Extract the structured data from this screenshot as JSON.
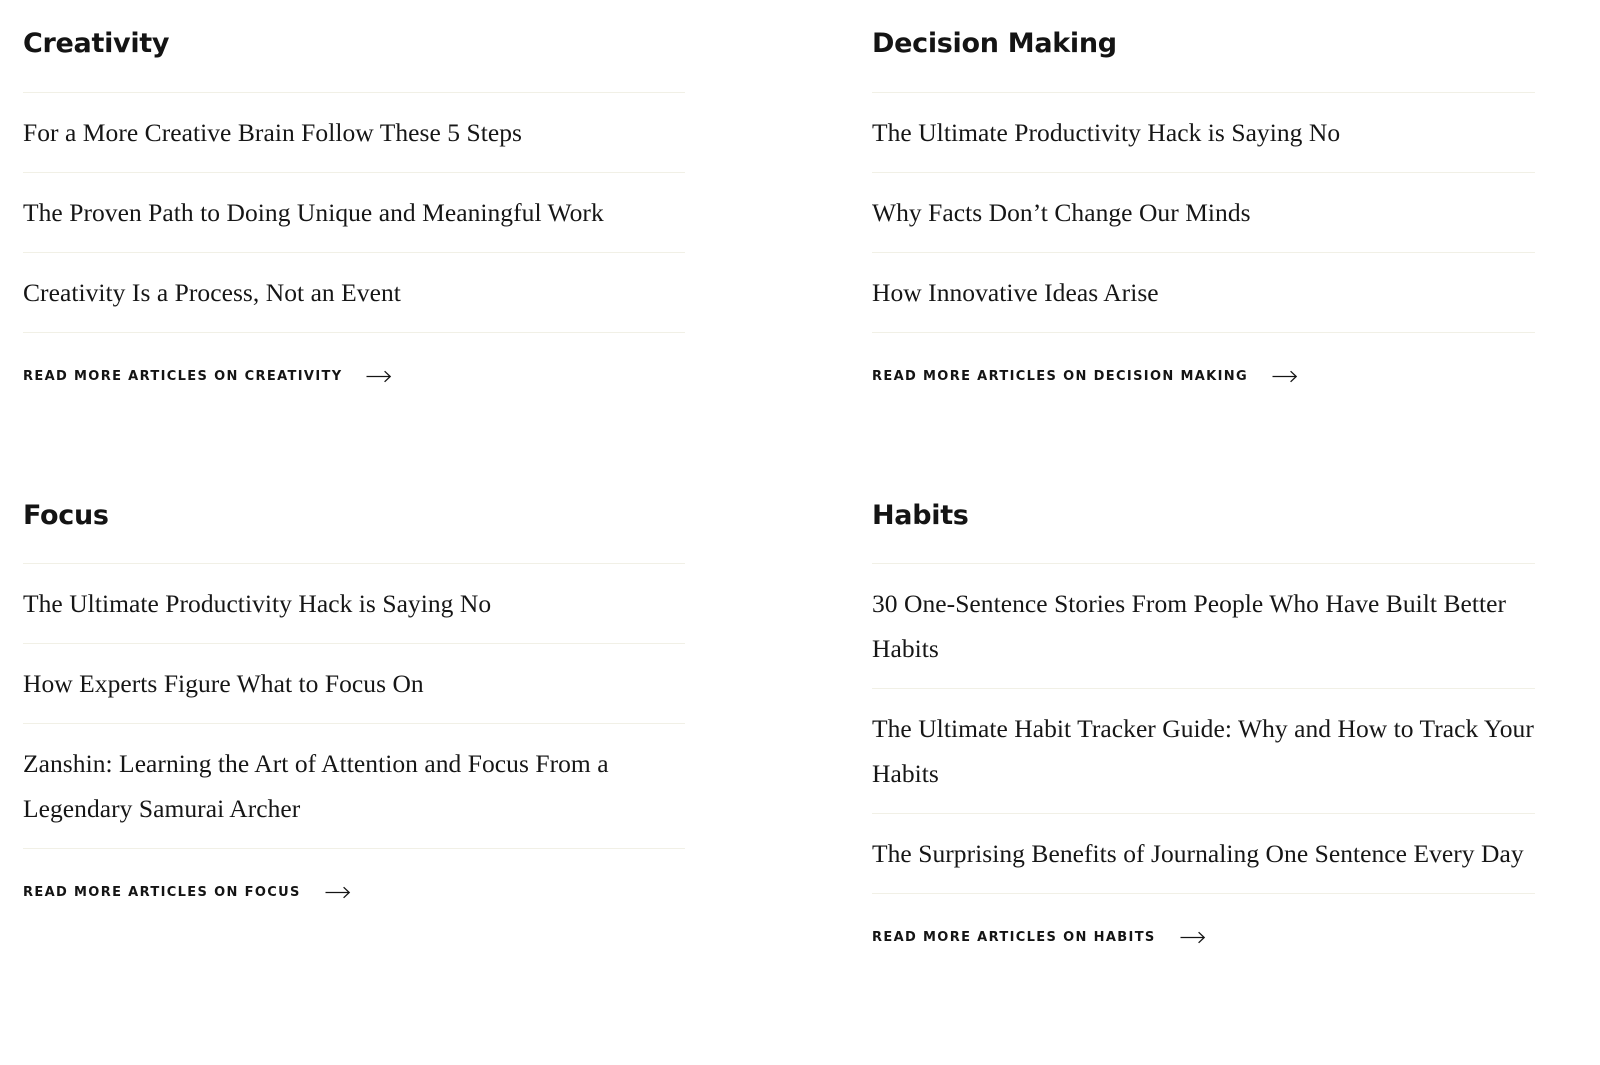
{
  "theme": {
    "background": "#ffffff",
    "text_color": "#161616",
    "heading_color": "#141414",
    "divider_color": "#f1f0e6"
  },
  "sections": [
    {
      "id": "creativity",
      "heading": "Creativity",
      "articles": [
        "For a More Creative Brain Follow These 5 Steps",
        "The Proven Path to Doing Unique and Meaningful Work",
        "Creativity Is a Process, Not an Event"
      ],
      "read_more_label": "READ MORE ARTICLES ON CREATIVITY",
      "read_more_icon": "arrow-right-icon"
    },
    {
      "id": "decision-making",
      "heading": "Decision Making",
      "articles": [
        "The Ultimate Productivity Hack is Saying No",
        "Why Facts Don’t Change Our Minds",
        "How Innovative Ideas Arise"
      ],
      "read_more_label": "READ MORE ARTICLES ON DECISION MAKING",
      "read_more_icon": "arrow-right-icon"
    },
    {
      "id": "focus",
      "heading": "Focus",
      "articles": [
        "The Ultimate Productivity Hack is Saying No",
        "How Experts Figure What to Focus On",
        "Zanshin: Learning the Art of Attention and Focus From a Legendary Samurai Archer"
      ],
      "read_more_label": "READ MORE ARTICLES ON FOCUS",
      "read_more_icon": "arrow-right-icon"
    },
    {
      "id": "habits",
      "heading": "Habits",
      "articles": [
        "30 One-Sentence Stories From People Who Have Built Better Habits",
        "The Ultimate Habit Tracker Guide: Why and How to Track Your Habits",
        "The Surprising Benefits of Journaling One Sentence Every Day"
      ],
      "read_more_label": "READ MORE ARTICLES ON HABITS",
      "read_more_icon": "arrow-right-icon"
    }
  ]
}
